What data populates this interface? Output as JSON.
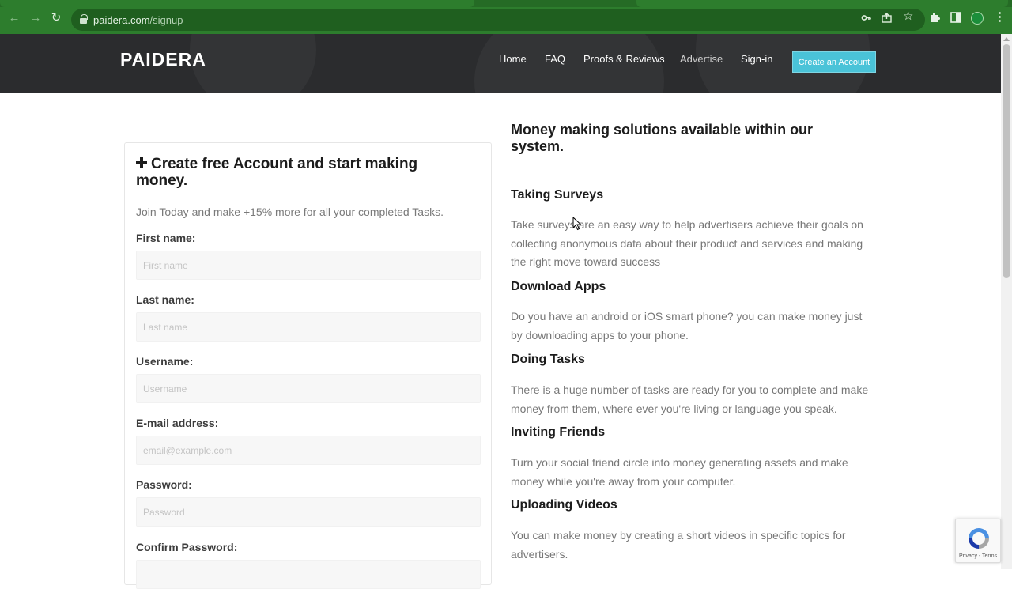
{
  "browser": {
    "url_domain": "paidera.com",
    "url_path": "/signup",
    "icons": [
      "back-icon",
      "forward-icon",
      "reload-icon",
      "lock-icon",
      "key-icon",
      "share-icon",
      "star-icon",
      "extensions-icon",
      "side-panel-icon",
      "profile-icon",
      "menu-icon"
    ]
  },
  "site": {
    "brand": "PAIDERA",
    "nav": [
      "Home",
      "FAQ",
      "Proofs & Reviews",
      "Advertise",
      "Sign-in"
    ],
    "cta": "Create an Account",
    "colors": {
      "header_bg": "#2b2c2e",
      "cta_bg": "#4ac3d8",
      "chrome_green": "#2d7d2d"
    }
  },
  "signup": {
    "title": "Create free Account and start making money.",
    "subtitle": "Join Today and make +15% more for all your completed Tasks.",
    "fields": [
      {
        "label": "First name:",
        "placeholder": "First name"
      },
      {
        "label": "Last name:",
        "placeholder": "Last name"
      },
      {
        "label": "Username:",
        "placeholder": "Username"
      },
      {
        "label": "E-mail address:",
        "placeholder": "email@example.com"
      },
      {
        "label": "Password:",
        "placeholder": "Password"
      },
      {
        "label": "Confirm Password:",
        "placeholder": ""
      }
    ]
  },
  "info": {
    "heading": "Money making solutions available within our system.",
    "sections": [
      {
        "title": "Taking Surveys",
        "body": "Take surveys are an easy way to help advertisers achieve their goals on collecting anonymous data about their product and services and making the right move toward success"
      },
      {
        "title": "Download Apps",
        "body": "Do you have an android or iOS smart phone? you can make money just by downloading apps to your phone."
      },
      {
        "title": "Doing Tasks",
        "body": "There is a huge number of tasks are ready for you to complete and make money from them, where ever you're living or language you speak."
      },
      {
        "title": "Inviting Friends",
        "body": "Turn your social friend circle into money generating assets and make money while you're away from your computer."
      },
      {
        "title": "Uploading Videos",
        "body": "You can make money by creating a short videos in specific topics for advertisers."
      }
    ]
  },
  "recaptcha": {
    "terms": "Privacy - Terms"
  }
}
